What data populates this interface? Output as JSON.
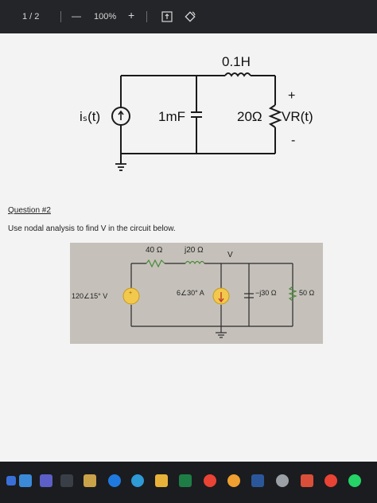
{
  "toolbar": {
    "page_indicator": "1 / 2",
    "zoom_out": "—",
    "zoom_level": "100%",
    "zoom_in": "+"
  },
  "circuit1": {
    "inductor": "0.1H",
    "source": "iₛ(t)",
    "capacitor": "1mF",
    "resistor": "20Ω",
    "plus": "+",
    "minus": "-",
    "voltage": "VR(t)"
  },
  "question": {
    "title": "Question #2",
    "text": "Use nodal analysis to find V in the circuit below."
  },
  "circuit2": {
    "r1": "40 Ω",
    "l1": "j20 Ω",
    "node": "V",
    "vsource": "120∠15° V",
    "isource": "6∠30° A",
    "cap": "−j30 Ω",
    "r2": "50 Ω"
  },
  "taskbar": {
    "icons": [
      "start-icon",
      "file-explorer-icon",
      "video-icon",
      "calendar-icon",
      "app-icon",
      "edge-icon",
      "folder-icon",
      "excel-icon",
      "chrome-icon",
      "media-icon",
      "word-icon",
      "settings-icon",
      "app2-icon",
      "chrome2-icon",
      "whatsapp-icon"
    ]
  },
  "colors": {
    "toolbar": "#242528",
    "page": "#f3f3f4",
    "source_yellow": "#f2c94c",
    "wire": "#1a1a1a"
  }
}
